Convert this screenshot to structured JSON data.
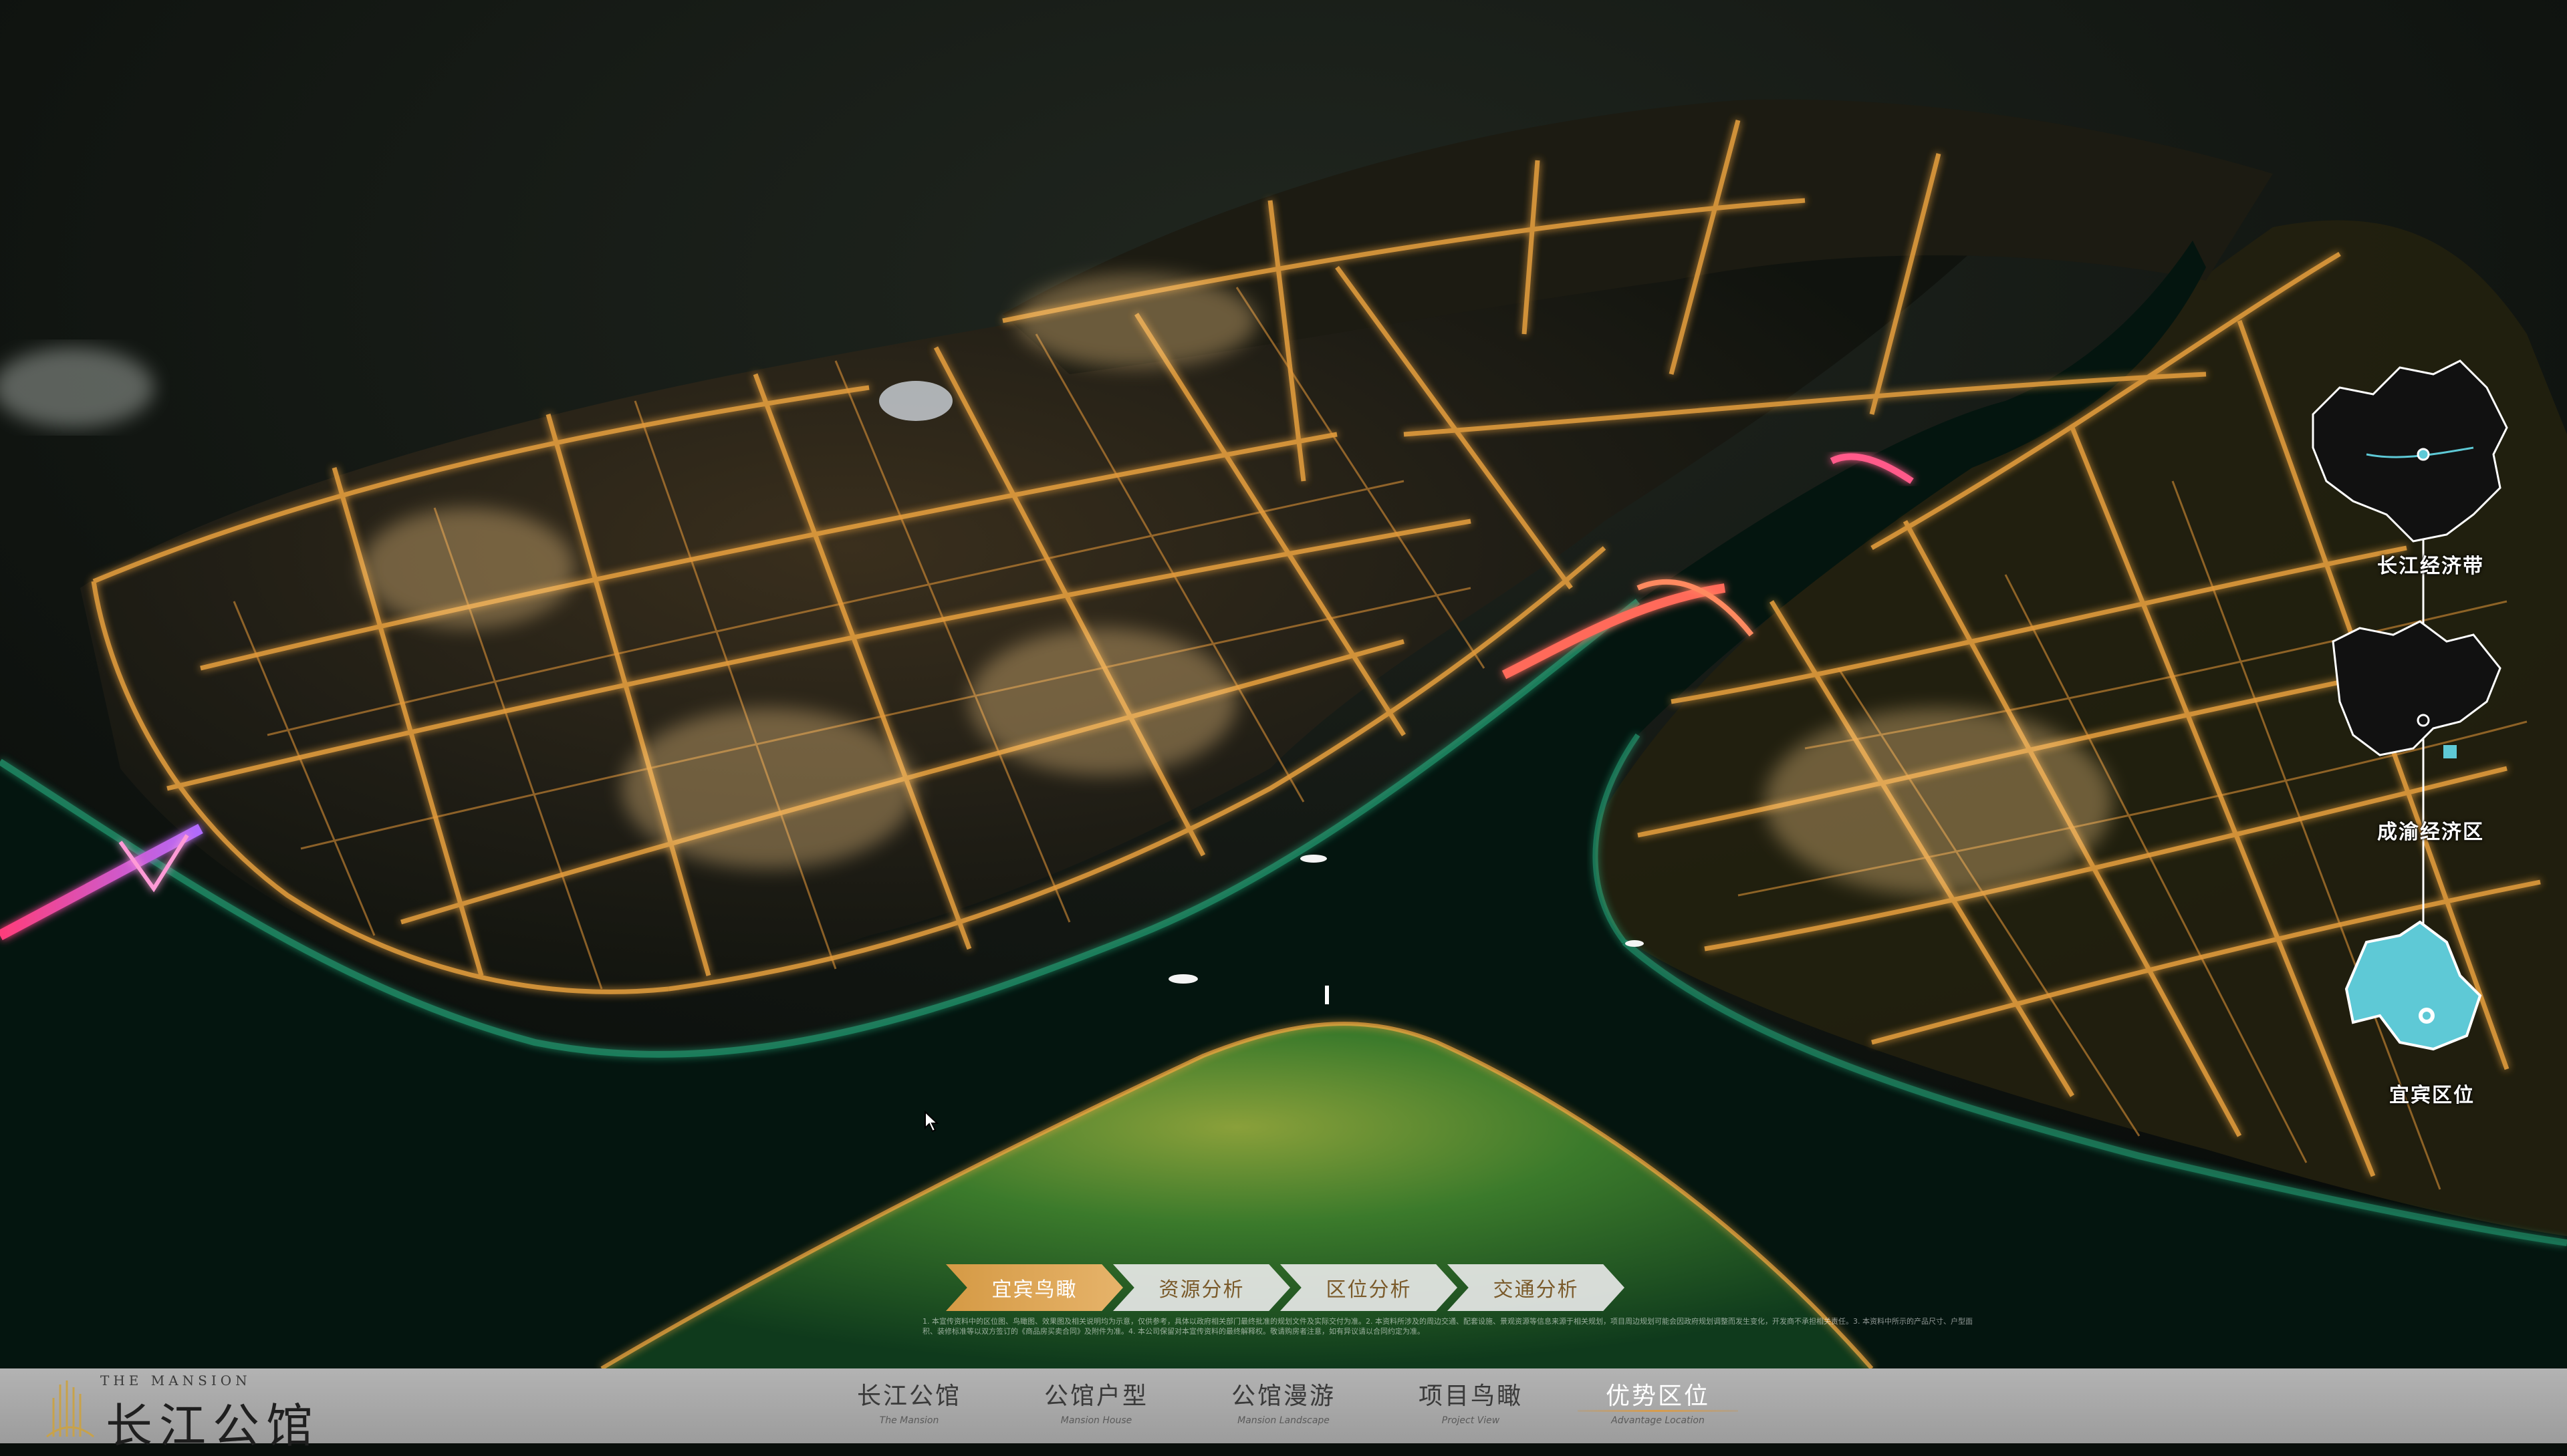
{
  "right_panel": {
    "labels": [
      "长江经济带",
      "成渝经济区",
      "宜宾区位"
    ]
  },
  "tabs": [
    {
      "label": "宜宾鸟瞰",
      "active": true
    },
    {
      "label": "资源分析",
      "active": false
    },
    {
      "label": "区位分析",
      "active": false
    },
    {
      "label": "交通分析",
      "active": false
    }
  ],
  "disclaimer": "1. 本宣传资料中的区位图、鸟瞰图、效果图及相关说明均为示意，仅供参考，具体以政府相关部门最终批准的规划文件及实际交付为准。2. 本资料所涉及的周边交通、配套设施、景观资源等信息来源于相关规划，项目周边规划可能会因政府规划调整而发生变化，开发商不承担相关责任。3. 本资料中所示的产品尺寸、户型面积、装修标准等以双方签订的《商品房买卖合同》及附件为准。4. 本公司保留对本宣传资料的最终解释权。敬请购房者注意，如有异议请以合同约定为准。",
  "footer": {
    "brand_en": "THE MANSION",
    "brand_cn": "长江公馆",
    "nav": [
      {
        "cn": "长江公馆",
        "en": "The Mansion",
        "active": false
      },
      {
        "cn": "公馆户型",
        "en": "Mansion House",
        "active": false
      },
      {
        "cn": "公馆漫游",
        "en": "Mansion Landscape",
        "active": false
      },
      {
        "cn": "项目鸟瞰",
        "en": "Project View",
        "active": false
      },
      {
        "cn": "优势区位",
        "en": "Advantage Location",
        "active": true
      }
    ]
  },
  "colors": {
    "road": "#f0a640",
    "river": "#04150f",
    "river_glow": "#2fd39a",
    "accent": "#d59a45",
    "map_highlight": "#5ec9d6"
  },
  "icons": [
    "brand-logo-icon",
    "cursor-arrow-icon",
    "location-dot-icon"
  ]
}
